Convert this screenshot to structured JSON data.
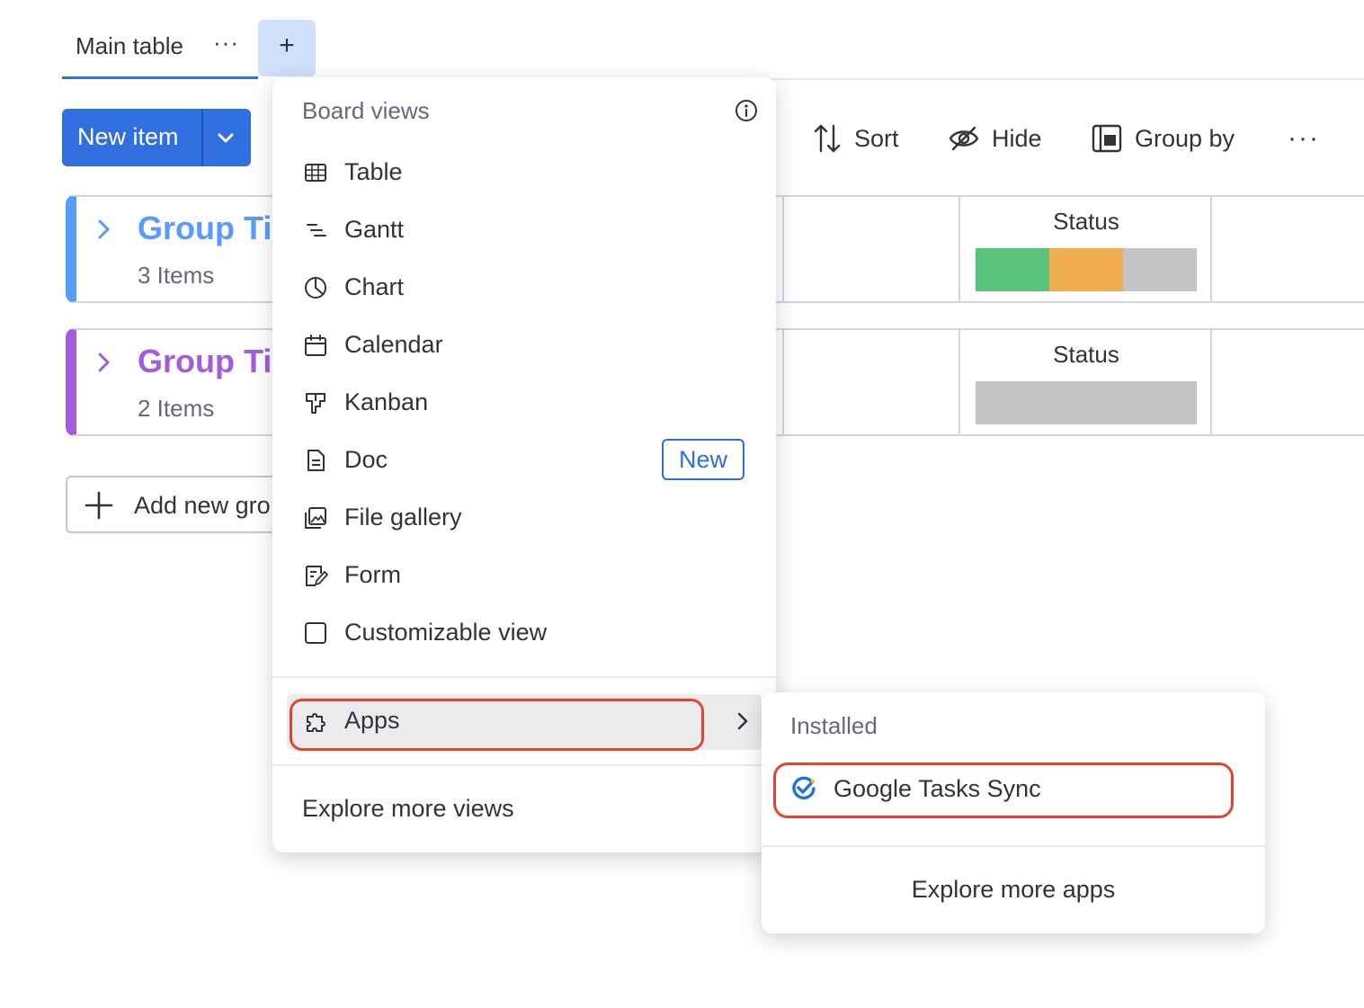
{
  "tabs": {
    "main_label": "Main table",
    "main_menu_icon": "more-horizontal-icon",
    "add_view_symbol": "+",
    "add_view_icon": "plus-icon"
  },
  "toolbar": {
    "new_item_label": "New item",
    "new_item_dropdown_icon": "chevron-down-icon",
    "sort_label": "Sort",
    "hide_label": "Hide",
    "group_by_label": "Group by",
    "more_icon": "more-horizontal-icon"
  },
  "groups": [
    {
      "title": "Group Ti",
      "count": "3 Items",
      "color": "#579bfc",
      "status_label": "Status",
      "status_segments": [
        {
          "color": "#5ac47d",
          "fraction": 0.333
        },
        {
          "color": "#f0ae4f",
          "fraction": 0.333
        },
        {
          "color": "#c4c4c4",
          "fraction": 0.334
        }
      ]
    },
    {
      "title": "Group Ti",
      "count": "2 Items",
      "color": "#a25ddc",
      "status_label": "Status",
      "status_segments": [
        {
          "color": "#c4c4c4",
          "fraction": 1.0
        }
      ]
    }
  ],
  "add_group_label": "Add new gro",
  "board_views_menu": {
    "heading": "Board views",
    "info_icon": "info-icon",
    "items": [
      {
        "label": "Table",
        "icon": "table-icon"
      },
      {
        "label": "Gantt",
        "icon": "gantt-icon"
      },
      {
        "label": "Chart",
        "icon": "chart-icon"
      },
      {
        "label": "Calendar",
        "icon": "calendar-icon"
      },
      {
        "label": "Kanban",
        "icon": "kanban-icon"
      },
      {
        "label": "Doc",
        "icon": "doc-icon",
        "badge": "New"
      },
      {
        "label": "File gallery",
        "icon": "file-gallery-icon"
      },
      {
        "label": "Form",
        "icon": "form-icon"
      },
      {
        "label": "Customizable view",
        "icon": "customizable-view-icon"
      }
    ],
    "apps_label": "Apps",
    "apps_icon": "puzzle-icon",
    "explore_label": "Explore more views"
  },
  "apps_submenu": {
    "heading": "Installed",
    "installed_app": "Google Tasks Sync",
    "installed_app_icon": "google-tasks-icon",
    "explore_label": "Explore more apps"
  },
  "colors": {
    "primary": "#2f6fe0",
    "highlight_outline": "#e2442f"
  }
}
